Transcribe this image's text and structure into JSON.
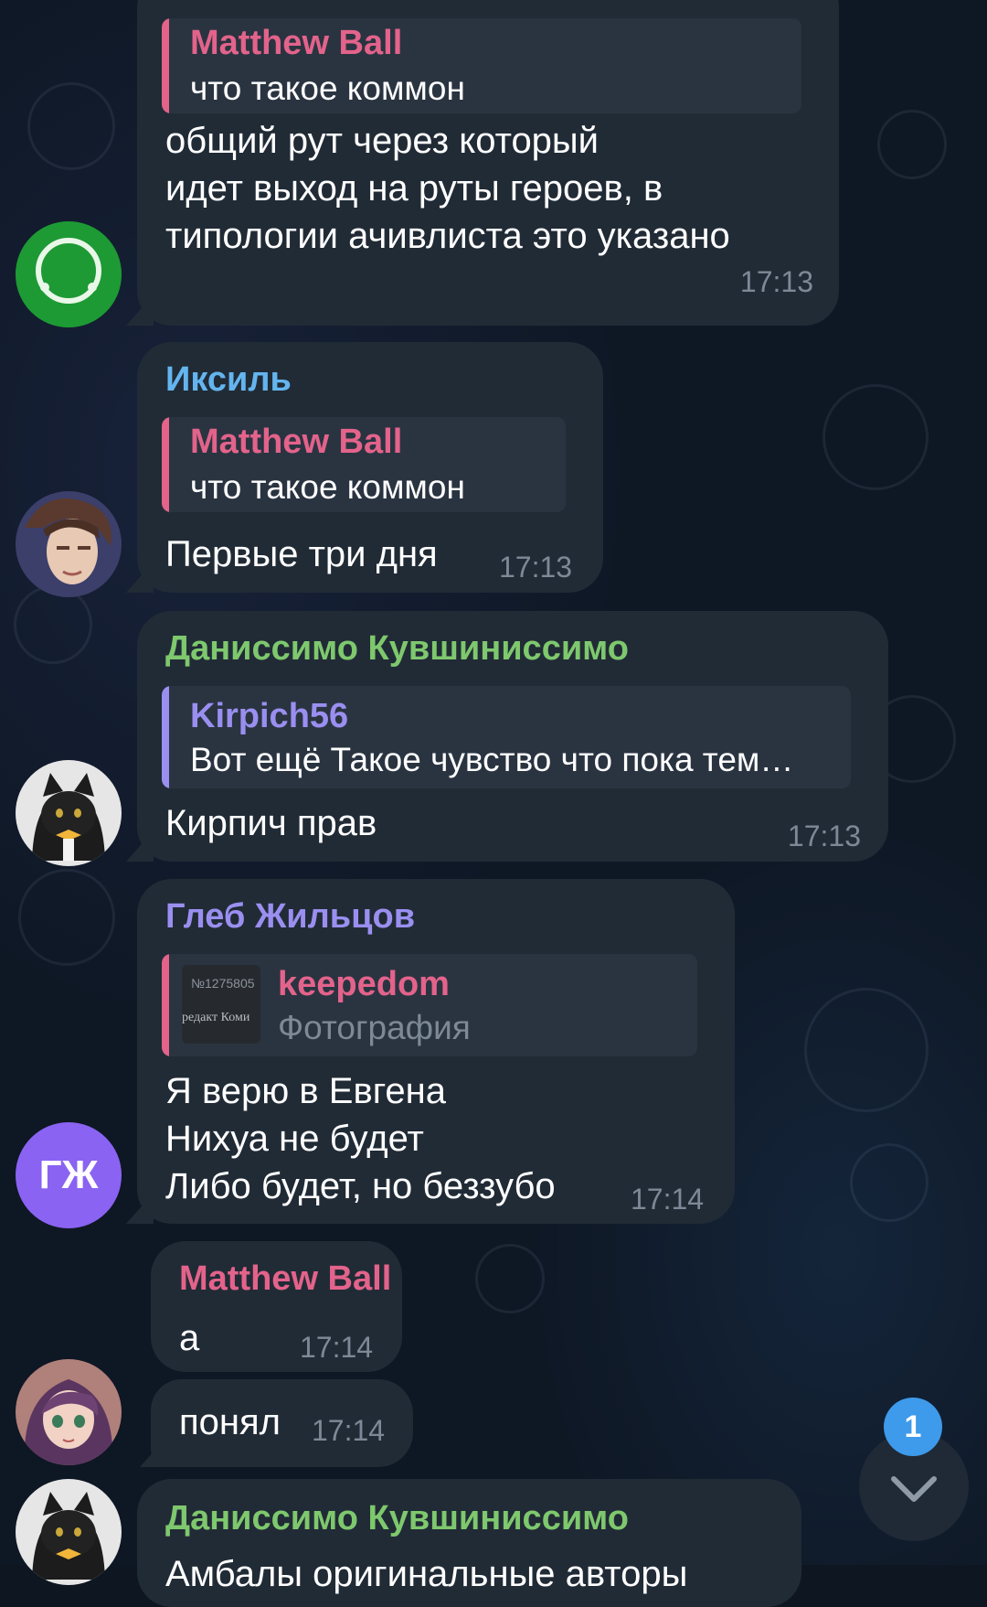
{
  "messages": [
    {
      "reply": {
        "name": "Matthew Ball",
        "text": "что такое коммон"
      },
      "text_lines": [
        "общий рут через который",
        "идет выход на руты героев, в",
        "типологии ачивлиста это указано"
      ],
      "time": "17:13"
    },
    {
      "sender": "Иксиль",
      "reply": {
        "name": "Matthew Ball",
        "text": "что такое коммон"
      },
      "text": "Первые три дня",
      "time": "17:13"
    },
    {
      "sender": "Даниссимо Кувшиниссимо",
      "reply": {
        "name": "Kirpich56",
        "text": "Вот ещё  Такое чувство что пока тем…"
      },
      "text": "Кирпич прав",
      "time": "17:13"
    },
    {
      "sender": "Глеб Жильцов",
      "reply": {
        "name": "keepedom",
        "text": "Фотография",
        "thumb_lines": [
          "№1275805",
          "редакт Коми"
        ]
      },
      "text_lines": [
        "Я верю в Евгена",
        "Нихуа не будет",
        "Либо будет, но беззубо"
      ],
      "time": "17:14"
    },
    {
      "sender": "Matthew Ball",
      "text": "а",
      "time": "17:14"
    },
    {
      "text": "понял",
      "time": "17:14"
    },
    {
      "sender": "Даниссимо Кувшиниссимо",
      "text": "Амбалы оригинальные авторы"
    }
  ],
  "avatars": {
    "gzh_initials": "ГЖ"
  },
  "scroll_button": {
    "unread_count": "1"
  },
  "colors": {
    "background": "#0e1724",
    "bubble": "#212b36",
    "reply_bg": "#2a3441",
    "pink": "#e3638b",
    "blue": "#64b5ef",
    "green": "#7ec86d",
    "violet": "#9a8ff0",
    "time": "#7d8996",
    "badge": "#3e9aea"
  }
}
